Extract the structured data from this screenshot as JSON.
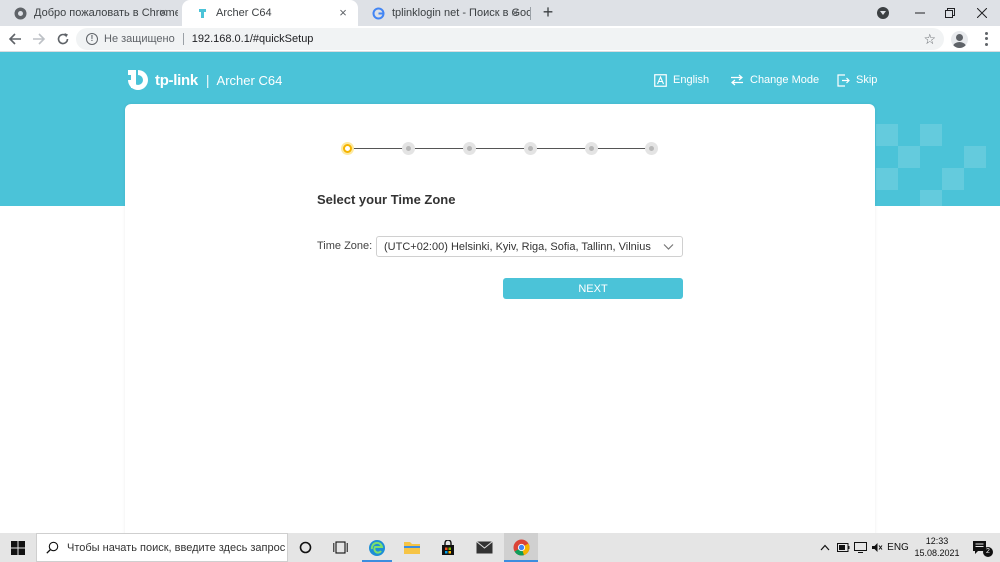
{
  "browser": {
    "tabs": [
      {
        "title": "Добро пожаловать в Chrome!",
        "icon": "chrome-icon",
        "active": false
      },
      {
        "title": "Archer C64",
        "icon": "tplink-favicon",
        "active": true
      },
      {
        "title": "tplinklogin net - Поиск в Google",
        "icon": "google-icon",
        "active": false
      }
    ],
    "new_tab_symbol": "+",
    "address": {
      "security_label": "Не защищено",
      "url": "192.168.0.1/#quickSetup"
    }
  },
  "header": {
    "brand": "tp-link",
    "separator": "|",
    "model": "Archer C64",
    "links": [
      {
        "label": "English",
        "icon": "language-icon"
      },
      {
        "label": "Change Mode",
        "icon": "swap-icon"
      },
      {
        "label": "Skip",
        "icon": "exit-icon"
      }
    ]
  },
  "wizard": {
    "total_steps": 6,
    "current_step": 1,
    "title": "Select your Time Zone",
    "time_zone_label": "Time Zone:",
    "time_zone_value": "(UTC+02:00) Helsinki, Kyiv, Riga, Sofia, Tallinn, Vilnius",
    "next_label": "NEXT"
  },
  "taskbar": {
    "search_placeholder": "Чтобы начать поиск, введите здесь запрос",
    "language": "ENG",
    "time": "12:33",
    "date": "15.08.2021",
    "notification_count": "2"
  },
  "colors": {
    "brand": "#4bc3d8",
    "active_step": "#f5b400"
  }
}
